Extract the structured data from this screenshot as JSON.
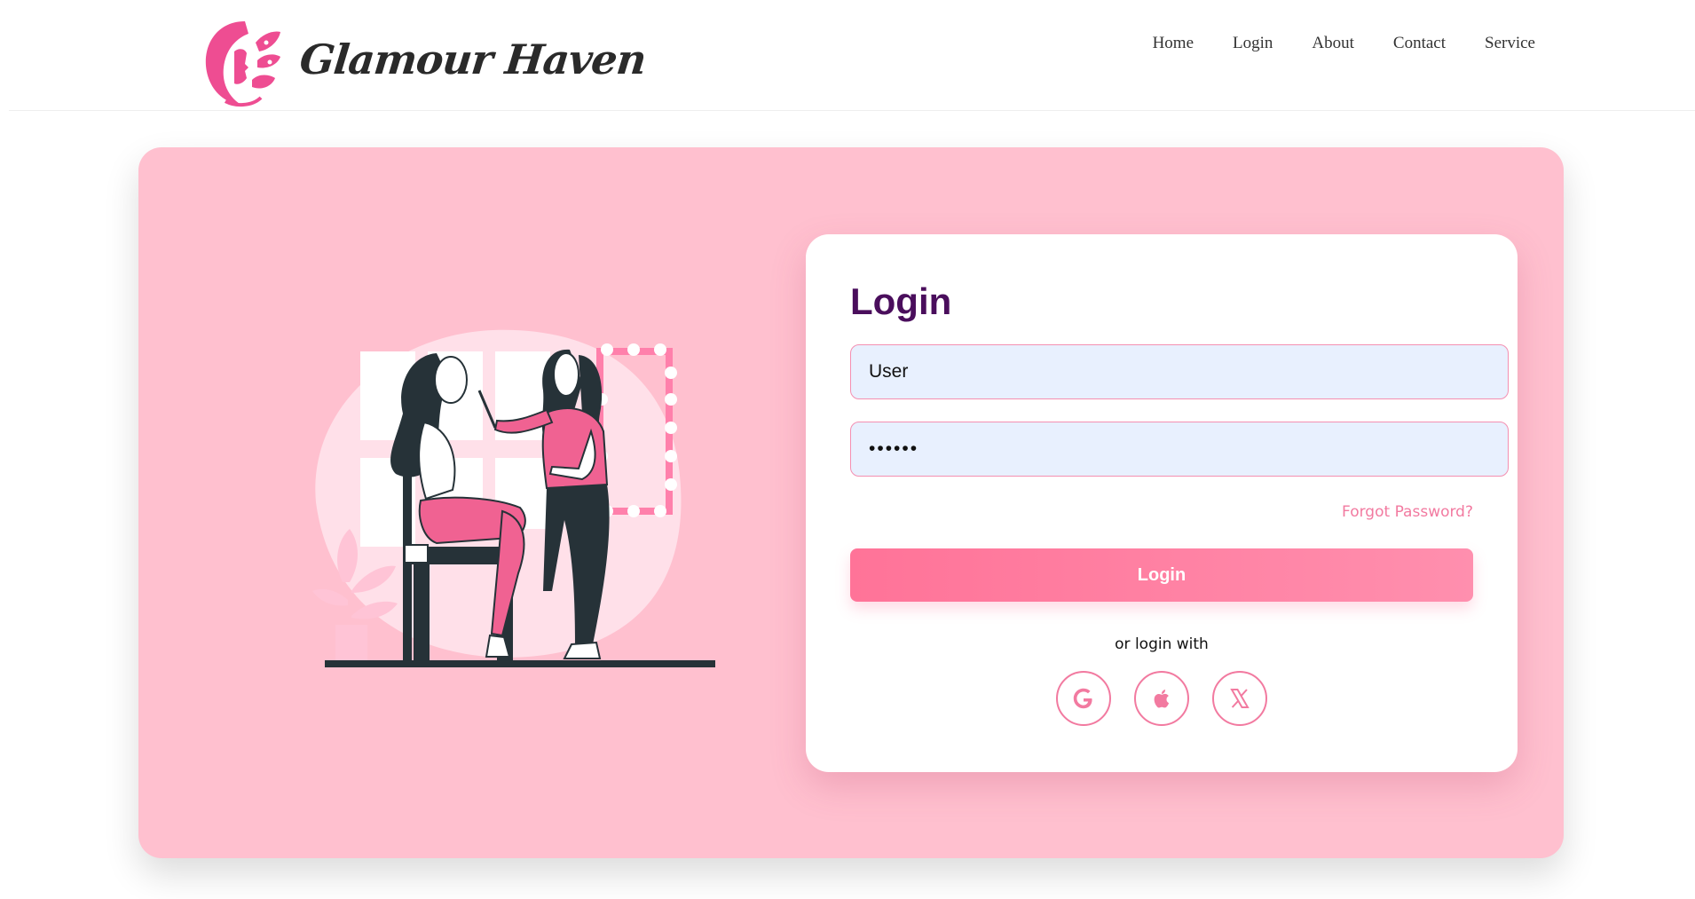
{
  "brand": {
    "name": "Glamour Haven",
    "logo_icon": "woman-face-flower-logo"
  },
  "nav": {
    "items": [
      {
        "label": "Home"
      },
      {
        "label": "Login"
      },
      {
        "label": "About"
      },
      {
        "label": "Contact"
      },
      {
        "label": "Service"
      }
    ]
  },
  "hero": {
    "illustration": "makeup-artist-illustration"
  },
  "login": {
    "title": "Login",
    "username_value": "User",
    "password_value": "••••••",
    "forgot_label": "Forgot Password?",
    "submit_label": "Login",
    "alt_text": "or login with",
    "social": [
      {
        "icon": "google-icon"
      },
      {
        "icon": "apple-icon"
      },
      {
        "icon": "x-icon"
      }
    ]
  },
  "colors": {
    "hero_bg": "#ffc0cf",
    "title": "#4a0e5c",
    "accent_pink": "#f27aa0",
    "button": "#ff7398",
    "input_bg": "#e8f0fe"
  }
}
